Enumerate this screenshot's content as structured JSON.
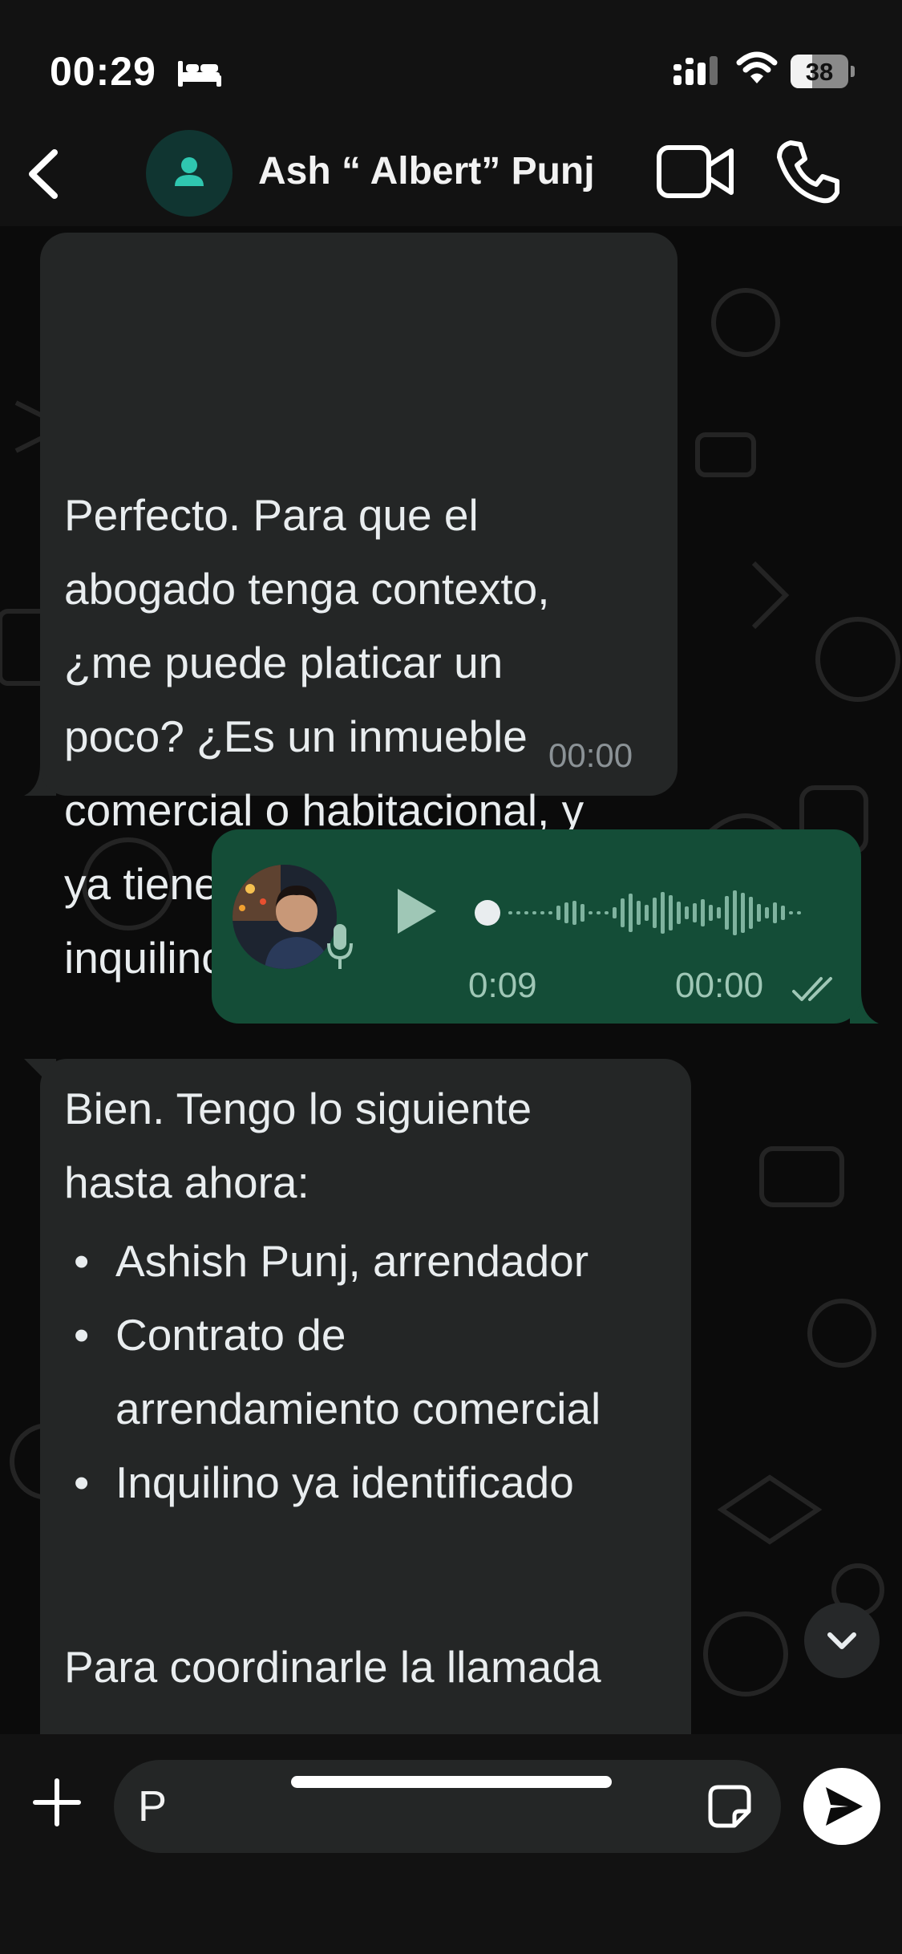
{
  "status_bar": {
    "time": "00:29",
    "battery_level": "38",
    "battery_fraction": 0.38
  },
  "header": {
    "contact_name": "Ash “ Albert” Punj"
  },
  "messages": {
    "first": {
      "text": "Perfecto. Para que el\nabogado tenga contexto,\n¿me puede platicar un\npoco? ¿Es un inmueble\ncomercial o habitacional, y\nya tiene identificado al\ninquilino?",
      "time": "00:00"
    },
    "voice": {
      "duration": "0:09",
      "time": "00:00",
      "status": "read"
    },
    "third": {
      "intro": "Bien. Tengo lo siguiente\nhasta ahora:",
      "items": [
        "Ashish Punj, arrendador",
        "Contrato de\narrendamiento comercial",
        "Inquilino ya identificado"
      ],
      "outro": "Para coordinarle la llamada"
    }
  },
  "composer": {
    "input_value": "P"
  },
  "icons": {
    "back": "chevron-left-icon",
    "video": "video-camera-icon",
    "phone": "phone-icon",
    "plus": "plus-icon",
    "sticker": "sticker-icon",
    "send": "send-icon",
    "scroll": "chevron-down-icon"
  },
  "colors": {
    "incoming_bubble": "#242626",
    "outgoing_bubble": "#144d37",
    "accent": "#25d366"
  }
}
